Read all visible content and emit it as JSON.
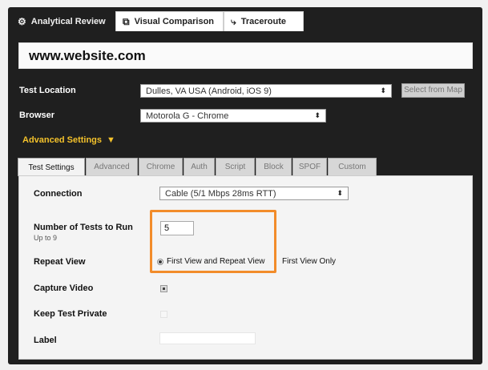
{
  "top_tabs": [
    {
      "label": "Analytical Review",
      "icon": "gear-icon"
    },
    {
      "label": "Visual Comparison",
      "icon": "compare-icon"
    },
    {
      "label": "Traceroute",
      "icon": "traceroute-icon"
    }
  ],
  "url": "www.website.com",
  "test_location": {
    "label": "Test Location",
    "value": "Dulles, VA USA (Android, iOS 9)",
    "button": "Select from Map"
  },
  "browser": {
    "label": "Browser",
    "value": "Motorola G - Chrome"
  },
  "advanced_toggle": "Advanced Settings",
  "settings_tabs": [
    "Test Settings",
    "Advanced",
    "Chrome",
    "Auth",
    "Script",
    "Block",
    "SPOF",
    "Custom"
  ],
  "settings": {
    "connection": {
      "label": "Connection",
      "value": "Cable (5/1 Mbps 28ms RTT)"
    },
    "num_tests": {
      "label": "Number of Tests to Run",
      "sublabel": "Up to 9",
      "value": "5"
    },
    "repeat_view": {
      "label": "Repeat View",
      "options": [
        "First View and Repeat View",
        "First View Only"
      ],
      "selected": 0
    },
    "capture_video": {
      "label": "Capture Video",
      "checked": true
    },
    "keep_private": {
      "label": "Keep Test Private",
      "checked": false
    },
    "label": {
      "label": "Label",
      "value": ""
    }
  },
  "colors": {
    "accent": "#f4c22b",
    "highlight": "#f28c2a",
    "panel_bg": "#1f1f1f"
  }
}
